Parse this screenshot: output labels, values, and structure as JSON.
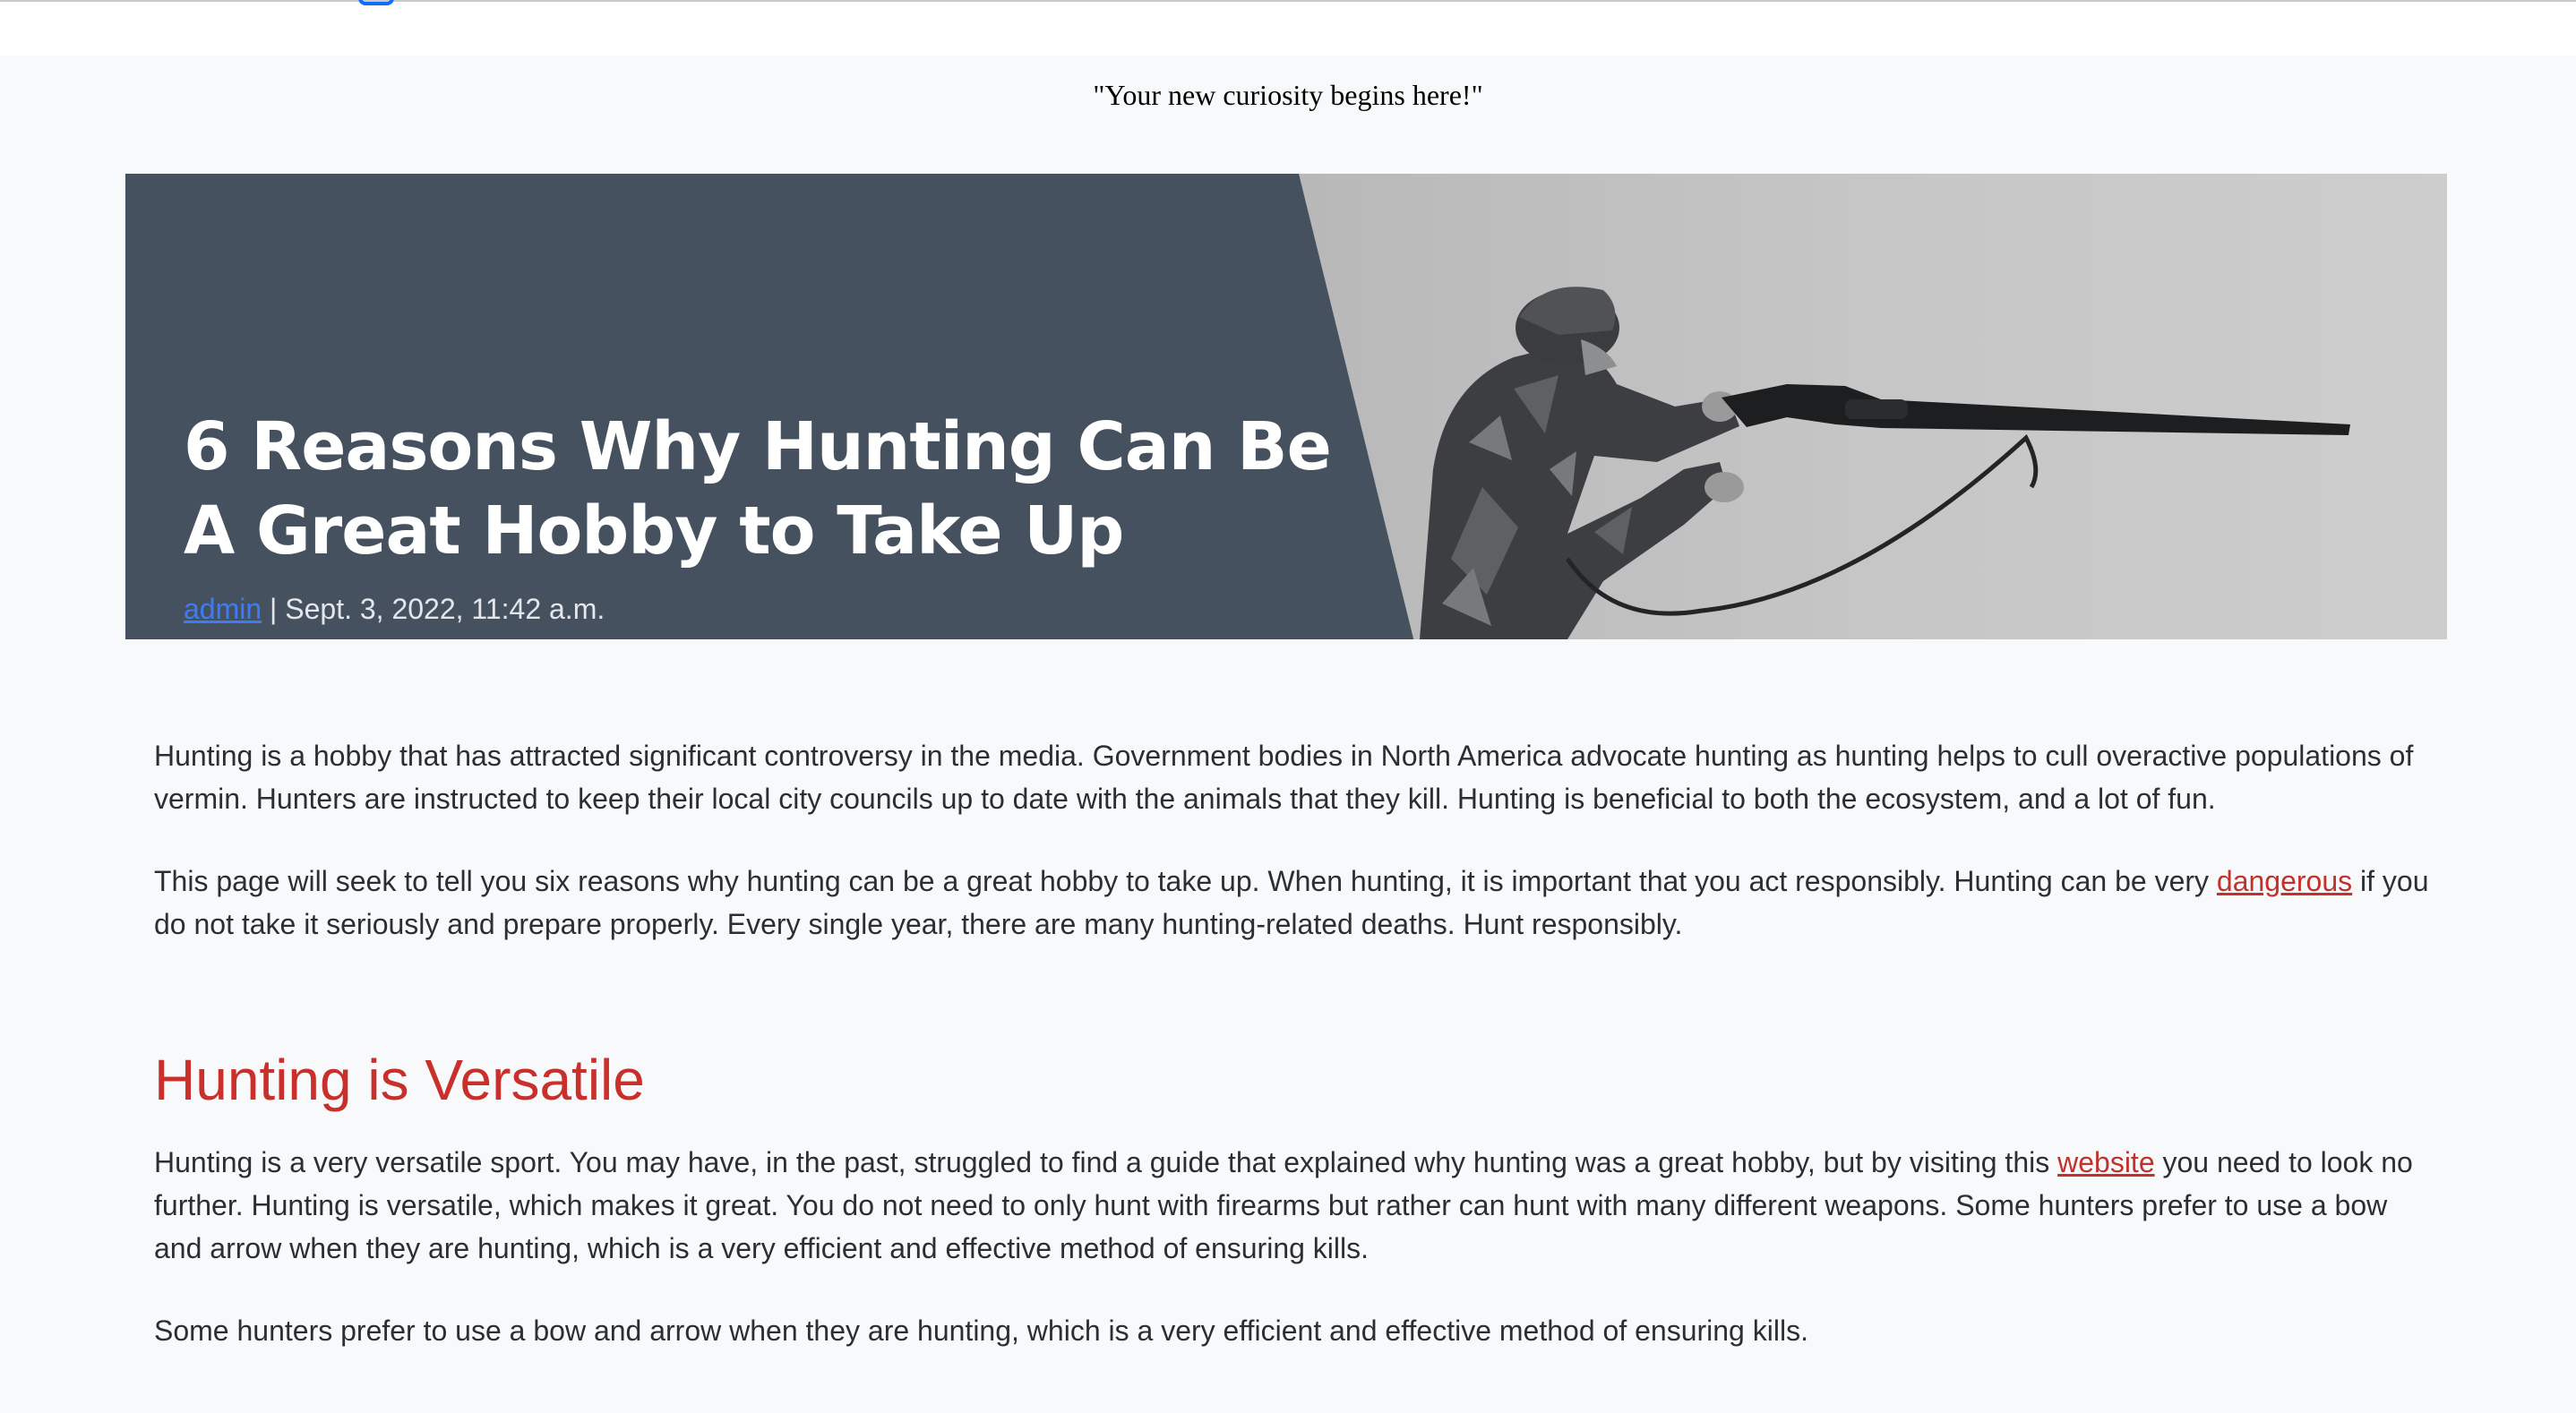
{
  "tagline": "\"Your new curiosity begins here!\"",
  "hero": {
    "title": "6 Reasons Why Hunting Can Be A Great Hobby to Take Up",
    "author": "admin",
    "date_sep": " | Sept. 3, 2022, 11:42 a.m.",
    "image_icon": "hunter-with-shotgun-photo"
  },
  "article": {
    "intro_1": "Hunting is a hobby that has attracted significant controversy in the media. Government bodies in North America advocate hunting as hunting helps to cull overactive populations of vermin. Hunters are instructed to keep their local city councils up to date with the animals that they kill. Hunting is beneficial to both the ecosystem, and a lot of fun.",
    "intro_2_a": "This page will seek to tell you six reasons why hunting can be a great hobby to take up. When hunting, it is important that you act responsibly. Hunting can be very ",
    "intro_2_link": "dangerous",
    "intro_2_b": " if you do not take it seriously and prepare properly. Every single year, there are many hunting-related deaths. Hunt responsibly.",
    "section_1_heading": "Hunting is Versatile",
    "section_1_p1_a": "Hunting is a very versatile sport. You may have, in the past, struggled to find a guide that explained why hunting was a great hobby, but by visiting this ",
    "section_1_p1_link": "website",
    "section_1_p1_b": " you need to look no further. Hunting is versatile, which makes it great. You do not need to only hunt with firearms but rather can hunt with many different weapons. Some hunters prefer to use a bow and arrow when they are hunting, which is a very efficient and effective method of ensuring kills.",
    "section_1_p2": "Some hunters prefer to use a bow and arrow when they are hunting, which is a very efficient and effective method of ensuring kills."
  },
  "colors": {
    "hero_bg": "#465160",
    "heading_red": "#c9302c",
    "link_red": "#c1322c",
    "link_blue": "#3d7cf5"
  }
}
